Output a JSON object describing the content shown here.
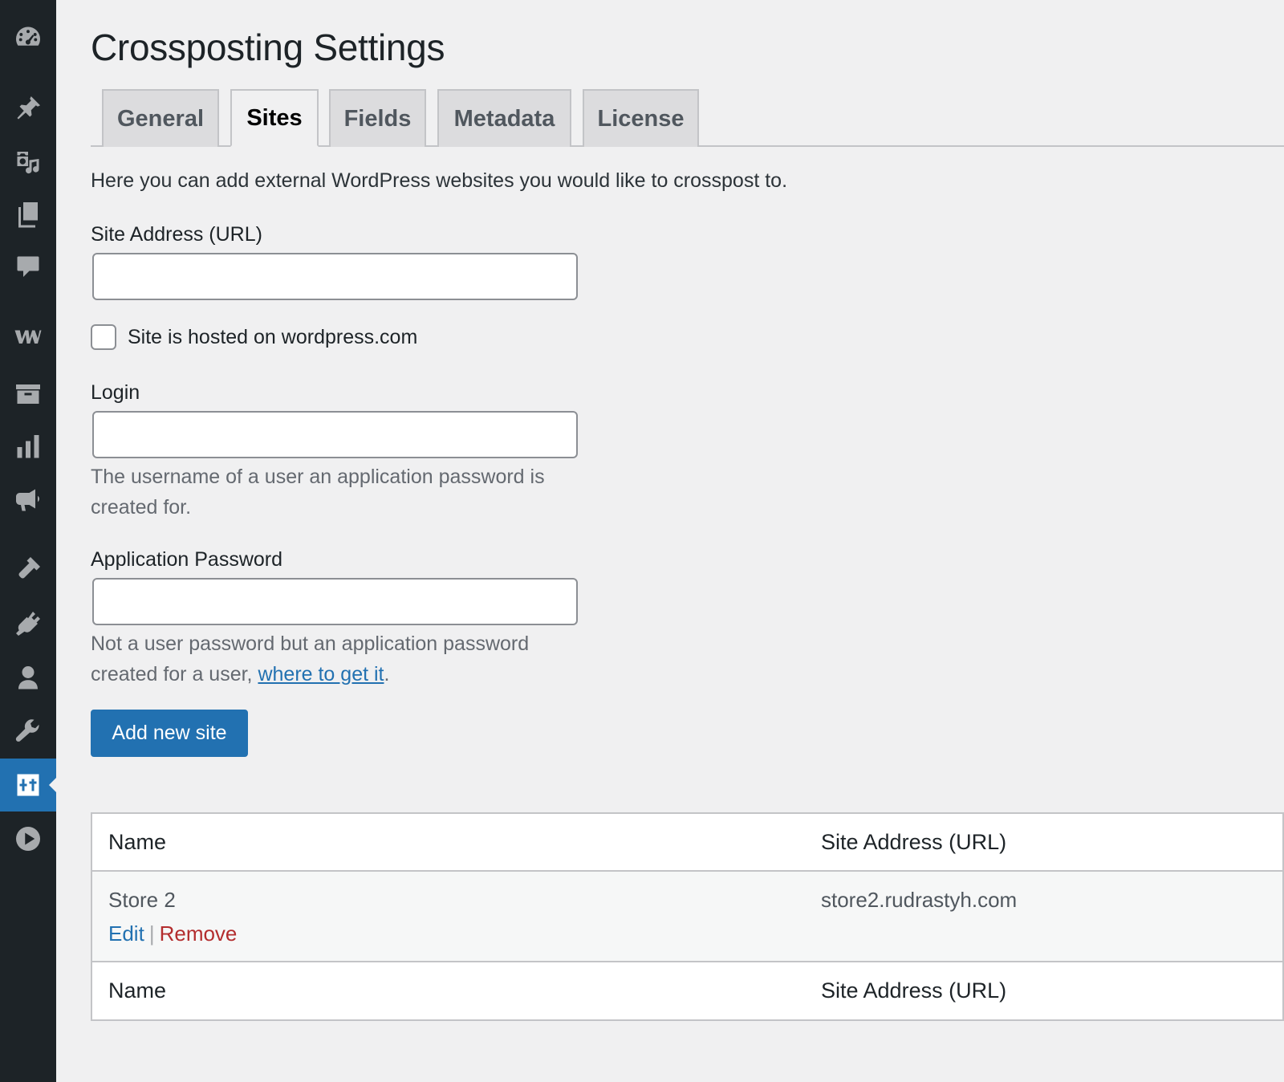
{
  "sidebar": {
    "items": [
      {
        "icon": "dashboard-icon"
      },
      {
        "icon": "pin-icon"
      },
      {
        "icon": "media-icon"
      },
      {
        "icon": "pages-icon"
      },
      {
        "icon": "comments-icon"
      },
      {
        "icon": "woocommerce-icon"
      },
      {
        "icon": "archive-icon"
      },
      {
        "icon": "analytics-icon"
      },
      {
        "icon": "marketing-icon"
      },
      {
        "icon": "appearance-icon"
      },
      {
        "icon": "plugins-icon"
      },
      {
        "icon": "users-icon"
      },
      {
        "icon": "tools-icon"
      },
      {
        "icon": "settings-icon",
        "active": true
      },
      {
        "icon": "play-icon"
      }
    ]
  },
  "page": {
    "title": "Crossposting Settings"
  },
  "tabs": [
    "General",
    "Sites",
    "Fields",
    "Metadata",
    "License"
  ],
  "active_tab": "Sites",
  "form": {
    "intro": "Here you can add external WordPress websites you would like to crosspost to.",
    "site_address_label": "Site Address (URL)",
    "site_address_value": "",
    "wpcom_checkbox_label": "Site is hosted on wordpress.com",
    "wpcom_checked": false,
    "login_label": "Login",
    "login_value": "",
    "login_desc": "The username of a user an application password is created for.",
    "app_password_label": "Application Password",
    "app_password_value": "",
    "app_password_desc_before": "Not a user password but an application password created for a user, ",
    "app_password_desc_link": "where to get it",
    "app_password_desc_after": ".",
    "submit_label": "Add new site"
  },
  "table": {
    "columns": [
      "Name",
      "Site Address (URL)"
    ],
    "rows": [
      {
        "name": "Store 2",
        "url": "store2.rudrastyh.com",
        "edit": "Edit",
        "separator": "|",
        "remove": "Remove"
      }
    ]
  },
  "colors": {
    "accent": "#2271b1",
    "sidebar_bg": "#1d2327",
    "danger": "#b32d2e",
    "page_bg": "#f0f0f1"
  }
}
